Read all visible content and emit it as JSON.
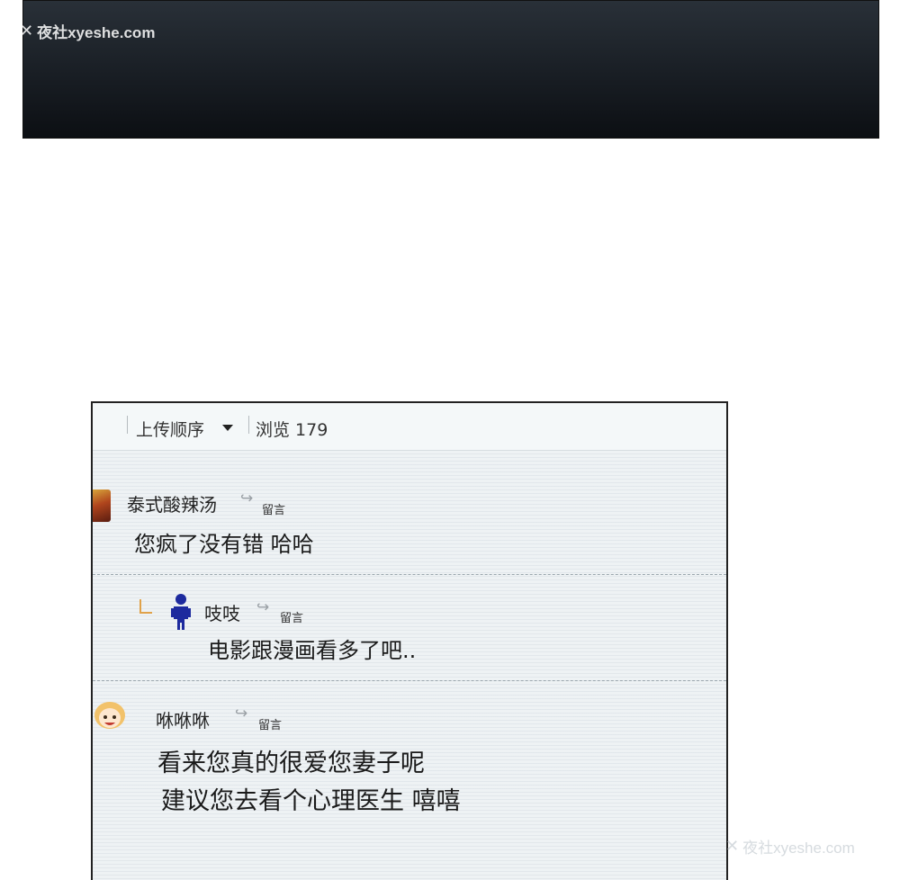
{
  "watermark": {
    "text": "夜社xyeshe.com",
    "glyph": "✕"
  },
  "toolbar": {
    "sort_label": "上传顺序",
    "views_label": "浏览 179"
  },
  "comments": [
    {
      "username": "泰式酸辣汤",
      "reply_label": "留言",
      "text": "您疯了没有错 哈哈"
    },
    {
      "username": "吱吱",
      "reply_label": "留言",
      "text": "电影跟漫画看多了吧.."
    },
    {
      "username": "咻咻咻",
      "reply_label": "留言",
      "text_lines": [
        "看来您真的很爱您妻子呢",
        "建议您去看个心理医生 嘻嘻"
      ]
    }
  ],
  "colors": {
    "dark_panel_top": "#293038",
    "dark_panel_bottom": "#0c0f13",
    "panel_bg": "#eef2f4",
    "accent_corner": "#e0a24a",
    "avatar_figure": "#1d2a9e"
  }
}
